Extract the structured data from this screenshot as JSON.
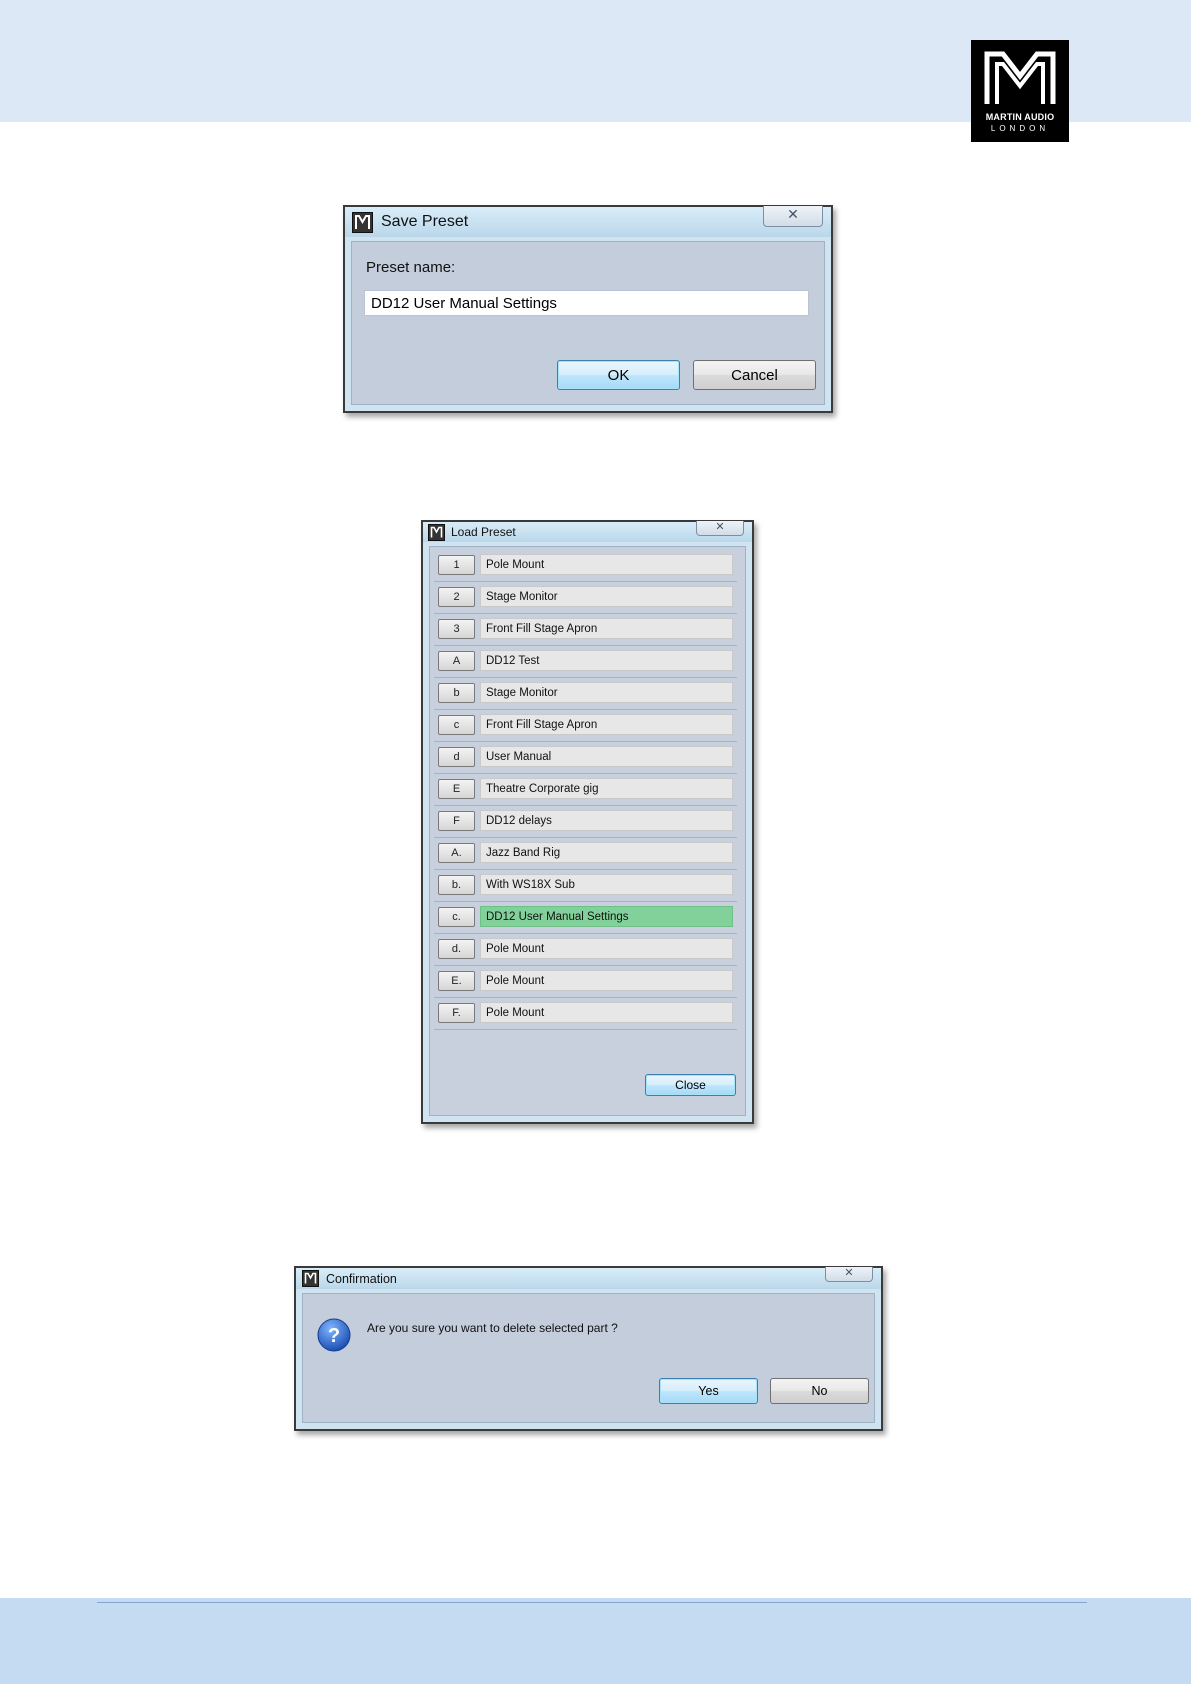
{
  "logo": {
    "brand": "MARTIN AUDIO",
    "city": "LONDON"
  },
  "save_dialog": {
    "title": "Save Preset",
    "preset_label": "Preset name:",
    "preset_value": "DD12 User Manual Settings",
    "close_symbol": "✕",
    "ok_label": "OK",
    "cancel_label": "Cancel"
  },
  "load_dialog": {
    "title": "Load Preset",
    "close_symbol": "✕",
    "close_label": "Close",
    "selected_index": 11,
    "presets": [
      {
        "slot": "1",
        "name": "Pole Mount"
      },
      {
        "slot": "2",
        "name": "Stage Monitor"
      },
      {
        "slot": "3",
        "name": "Front Fill Stage Apron"
      },
      {
        "slot": "A",
        "name": "DD12 Test"
      },
      {
        "slot": "b",
        "name": "Stage Monitor"
      },
      {
        "slot": "c",
        "name": "Front Fill Stage Apron"
      },
      {
        "slot": "d",
        "name": "User Manual"
      },
      {
        "slot": "E",
        "name": "Theatre Corporate gig"
      },
      {
        "slot": "F",
        "name": "DD12 delays"
      },
      {
        "slot": "A.",
        "name": "Jazz Band Rig"
      },
      {
        "slot": "b.",
        "name": "With WS18X Sub"
      },
      {
        "slot": "c.",
        "name": "DD12 User Manual Settings"
      },
      {
        "slot": "d.",
        "name": "Pole Mount"
      },
      {
        "slot": "E.",
        "name": "Pole Mount"
      },
      {
        "slot": "F.",
        "name": "Pole Mount"
      }
    ]
  },
  "confirm_dialog": {
    "title": "Confirmation",
    "close_symbol": "✕",
    "message": "Are you sure you want to delete selected part ?",
    "yes_label": "Yes",
    "no_label": "No",
    "icon": "question-icon"
  },
  "colors": {
    "header_band": "#dde8f6",
    "footer_band": "#c5dbf2",
    "selected_row": "#82d19a",
    "default_button": "#bde6fd"
  }
}
